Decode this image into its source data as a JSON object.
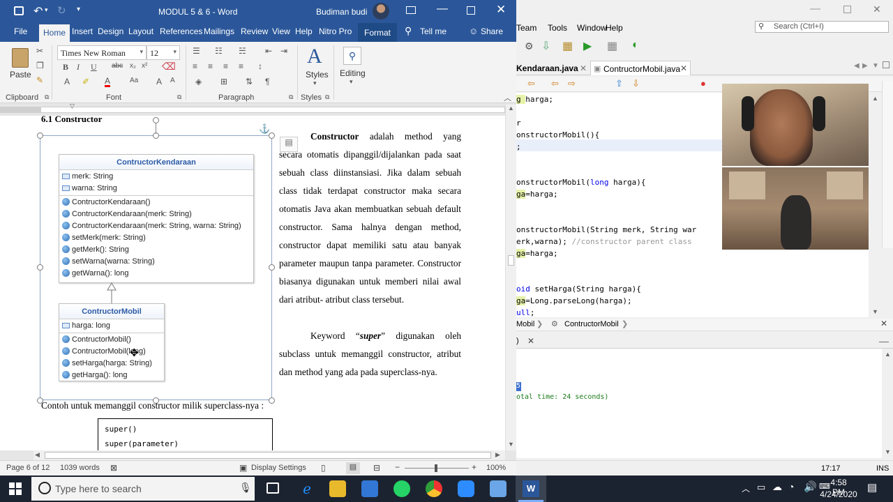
{
  "word": {
    "title": "MODUL 5 & 6  -  Word",
    "user": "Budiman budi",
    "tabs": [
      "File",
      "Home",
      "Insert",
      "Design",
      "Layout",
      "References",
      "Mailings",
      "Review",
      "View",
      "Help",
      "Nitro Pro",
      "Format"
    ],
    "tell_me": "Tell me",
    "share": "Share",
    "ribbon": {
      "paste": "Paste",
      "clipboard": "Clipboard",
      "font_name": "Times New Roman",
      "font_size": "12",
      "font": "Font",
      "paragraph": "Paragraph",
      "styles": "Styles",
      "styles_group": "Styles",
      "editing": "Editing"
    },
    "heading_partial": "6.1 Constructor",
    "uml": {
      "parent": {
        "name": "ContructorKendaraan",
        "fields": [
          "merk: String",
          "warna: String"
        ],
        "methods": [
          "ContructorKendaraan()",
          "ContructorKendaraan(merk: String)",
          "ContructorKendaraan(merk: String, warna: String)",
          "setMerk(merk: String)",
          "getMerk(): String",
          "setWarna(warna: String)",
          "getWarna(): long"
        ]
      },
      "child": {
        "name": "ContructorMobil",
        "fields": [
          "harga: long"
        ],
        "methods": [
          "ContructorMobil()",
          "ContructorMobil(long)",
          "setHarga(harga: String)",
          "getHarga(): long"
        ]
      }
    },
    "paragraph1": {
      "bold": "Constructor",
      "text": " adalah method yang secara otomatis dipanggil/dijalankan pada saat sebuah class diinstansiasi. Jika dalam sebuah class tidak terdapat constructor maka secara otomatis Java akan membuatkan sebuah default constructor. Sama halnya dengan method, constructor dapat memiliki satu atau banyak parameter maupun tanpa parameter. Constructor biasanya digunakan untuk memberi nilai awal dari atribut- atribut class tersebut."
    },
    "paragraph2": {
      "pre": "Keyword “",
      "em": "super",
      "post": "” digunakan oleh subclass untuk memanggil constructor, atribut dan method yang ada pada superclass-nya."
    },
    "example_caption": "Contoh untuk memanggil constructor milik superclass-nya :",
    "code_box": [
      "super()",
      "super(parameter)"
    ],
    "status": {
      "page": "Page 6 of 12",
      "words": "1039 words",
      "display": "Display Settings",
      "zoom": "100%"
    }
  },
  "ide": {
    "menu": [
      "Team",
      "Tools",
      "Window",
      "Help"
    ],
    "search_placeholder": "Search (Ctrl+I)",
    "tabs": [
      "Kendaraan.java",
      "ContructorMobil.java"
    ],
    "code_lines": [
      {
        "t": "g harga;"
      },
      {
        "t": ""
      },
      {
        "t": "r"
      },
      {
        "t": "onstructorMobil(){"
      },
      {
        "t": ";"
      },
      {
        "t": ""
      },
      {
        "t": ""
      },
      {
        "t": "onstructorMobil(long harga){"
      },
      {
        "t": "ga=harga;"
      },
      {
        "t": ""
      },
      {
        "t": ""
      },
      {
        "t": "onstructorMobil(String merk, String war"
      },
      {
        "t": "erk,warna); //constructor parent class"
      },
      {
        "t": "ga=harga;"
      },
      {
        "t": ""
      },
      {
        "t": ""
      },
      {
        "t": "oid setHarga(String harga){"
      },
      {
        "t": "ga=Long.parseLong(harga);"
      },
      {
        "t": "ull;"
      }
    ],
    "breadcrumb": [
      "Mobil",
      "ContructorMobil"
    ],
    "output_tab": ")",
    "output_lines": [
      "5",
      "otal time: 24 seconds)"
    ],
    "status_pos": "17:17",
    "status_mode": "INS"
  },
  "taskbar": {
    "search_placeholder": "Type here to search",
    "time": "4:58 PM",
    "date": "4/24/2020"
  },
  "colors": {
    "word_blue": "#2b579a",
    "taskbar": "#1c2330",
    "uml_title": "#2a5aa6"
  }
}
